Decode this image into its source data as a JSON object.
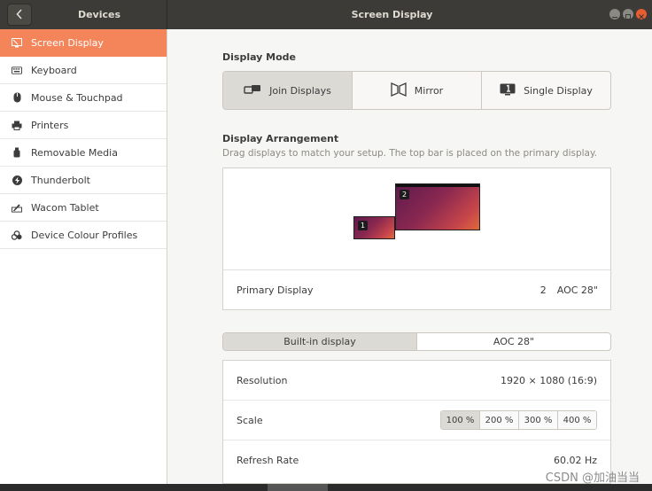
{
  "header": {
    "left_title": "Devices",
    "title": "Screen Display"
  },
  "sidebar": {
    "items": [
      {
        "label": "Screen Display",
        "icon": "display-icon"
      },
      {
        "label": "Keyboard",
        "icon": "keyboard-icon"
      },
      {
        "label": "Mouse & Touchpad",
        "icon": "mouse-icon"
      },
      {
        "label": "Printers",
        "icon": "printer-icon"
      },
      {
        "label": "Removable Media",
        "icon": "usb-icon"
      },
      {
        "label": "Thunderbolt",
        "icon": "thunderbolt-icon"
      },
      {
        "label": "Wacom Tablet",
        "icon": "tablet-icon"
      },
      {
        "label": "Device Colour Profiles",
        "icon": "colour-profile-icon"
      }
    ]
  },
  "display_mode": {
    "title": "Display Mode",
    "options": [
      {
        "label": "Join Displays",
        "icon": "join-displays-icon",
        "active": true
      },
      {
        "label": "Mirror",
        "icon": "mirror-icon",
        "active": false
      },
      {
        "label": "Single Display",
        "icon": "single-display-icon",
        "active": false
      }
    ]
  },
  "arrangement": {
    "title": "Display Arrangement",
    "subtitle": "Drag displays to match your setup. The top bar is placed on the primary display.",
    "displays": [
      {
        "number": "1"
      },
      {
        "number": "2"
      }
    ],
    "primary_label": "Primary Display",
    "primary_number": "2",
    "primary_name": "AOC 28\""
  },
  "tabs": [
    {
      "label": "Built-in display",
      "active": true
    },
    {
      "label": "AOC 28\"",
      "active": false
    }
  ],
  "settings": {
    "resolution_label": "Resolution",
    "resolution_value": "1920 × 1080 (16:9)",
    "scale_label": "Scale",
    "scale_options": [
      "100 %",
      "200 %",
      "300 %",
      "400 %"
    ],
    "scale_selected": "100 %",
    "refresh_label": "Refresh Rate",
    "refresh_value": "60.02 Hz"
  },
  "watermark": "CSDN @加油当当",
  "colors": {
    "accent": "#f4845a",
    "headerbar": "#3c3b37"
  }
}
